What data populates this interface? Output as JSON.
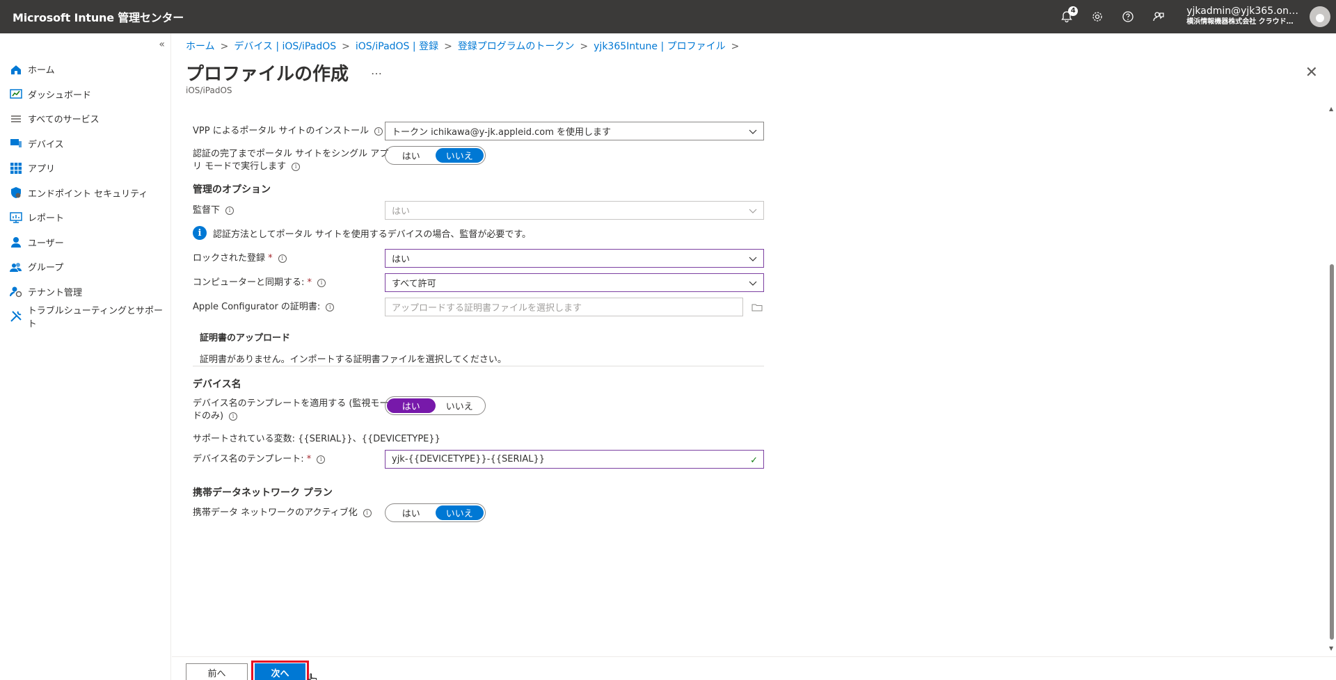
{
  "topbar": {
    "title": "Microsoft Intune 管理センター",
    "notification_count": "4",
    "account_name": "yjkadmin@yjk365.on…",
    "account_org": "横浜情報機器株式会社 クラウド…"
  },
  "sidebar": {
    "items": [
      {
        "label": "ホーム",
        "icon": "home-icon"
      },
      {
        "label": "ダッシュボード",
        "icon": "dashboard-icon"
      },
      {
        "label": "すべてのサービス",
        "icon": "list-icon"
      },
      {
        "label": "デバイス",
        "icon": "devices-icon"
      },
      {
        "label": "アプリ",
        "icon": "apps-icon"
      },
      {
        "label": "エンドポイント セキュリティ",
        "icon": "endpoint-security-icon"
      },
      {
        "label": "レポート",
        "icon": "reports-icon"
      },
      {
        "label": "ユーザー",
        "icon": "user-icon"
      },
      {
        "label": "グループ",
        "icon": "groups-icon"
      },
      {
        "label": "テナント管理",
        "icon": "tenant-admin-icon"
      },
      {
        "label": "トラブルシューティングとサポート",
        "icon": "troubleshooting-icon"
      }
    ]
  },
  "breadcrumb": [
    "ホーム",
    "デバイス | iOS/iPadOS",
    "iOS/iPadOS | 登録",
    "登録プログラムのトークン",
    "yjk365Intune | プロファイル"
  ],
  "page": {
    "title": "プロファイルの作成",
    "more": "…",
    "subtitle": "iOS/iPadOS"
  },
  "form": {
    "vpp_label": "VPP によるポータル サイトのインストール",
    "vpp_value": "トークン ichikawa@y-jk.appleid.com を使用します",
    "single_app_label_1": "認証の完了までポータル サイトをシングル アプ",
    "single_app_label_2": "リ モードで実行します",
    "management_section": "管理のオプション",
    "supervised_label": "監督下",
    "supervised_value": "はい",
    "info_message": "認証方法としてポータル サイトを使用するデバイスの場合、監督が必要です。",
    "locked_label": "ロックされた登録",
    "locked_value": "はい",
    "sync_label": "コンピューターと同期する:",
    "sync_value": "すべて許可",
    "configurator_label": "Apple Configurator の証明書:",
    "configurator_placeholder": "アップロードする証明書ファイルを選択します",
    "cert_upload_title": "証明書のアップロード",
    "cert_none_text": "証明書がありません。インポートする証明書ファイルを選択してください。",
    "device_name_section": "デバイス名",
    "apply_template_label_1": "デバイス名のテンプレートを適用する (監視モー",
    "apply_template_label_2": "ドのみ)",
    "supported_vars": "サポートされている変数: {{SERIAL}}、{{DEVICETYPE}}",
    "template_label": "デバイス名のテンプレート:",
    "template_value": "yjk-{{DEVICETYPE}}-{{SERIAL}}",
    "cellular_section": "携帯データネットワーク プラン",
    "cellular_label": "携帯データ ネットワークのアクティブ化",
    "required_mark": "*",
    "yes": "はい",
    "no": "いいえ"
  },
  "toggles": {
    "single_app": "いいえ",
    "apply_template": "はい",
    "cellular": "いいえ"
  },
  "footer": {
    "prev": "前へ",
    "next": "次へ"
  },
  "colors": {
    "topbar": "#3b3a39",
    "accent_blue": "#0078d4",
    "accent_purple": "#7719aa",
    "highlight_red": "#e81123"
  }
}
